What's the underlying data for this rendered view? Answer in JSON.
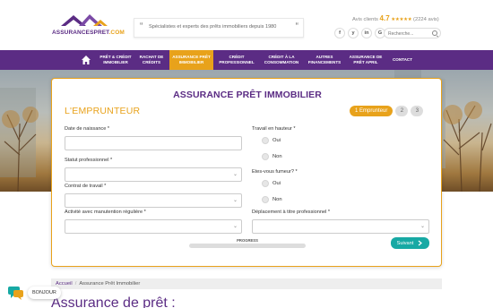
{
  "header": {
    "logo_text_main": "ASSURANCESPRET",
    "logo_text_accent": ".COM",
    "slogan": "Spécialistes et experts des prêts immobiliers depuis 1980",
    "reviews_label": "Avis clients",
    "reviews_score": "4.7",
    "reviews_stars": "★★★★★",
    "reviews_count": "(2224 avis)",
    "socials": [
      "f",
      "y",
      "in",
      "G"
    ],
    "search_placeholder": "Recherche..."
  },
  "nav": {
    "items": [
      {
        "label": "PRÊT & CRÉDIT IMMOBILIER"
      },
      {
        "label": "RACHAT DE CRÉDITS"
      },
      {
        "label": "ASSURANCE PRÊT IMMOBILIER"
      },
      {
        "label": "CRÉDIT PROFESSIONNEL"
      },
      {
        "label": "CRÉDIT À LA CONSOMMATION"
      },
      {
        "label": "AUTRES FINANCEMENTS"
      },
      {
        "label": "ASSURANCE DE PRÊT APRIL"
      },
      {
        "label": "CONTACT"
      }
    ],
    "active_index": 2
  },
  "form": {
    "title": "ASSURANCE PRÊT IMMOBILIER",
    "section": "L'EMPRUNTEUR",
    "steps": [
      "1 Emprunteur",
      "2",
      "3"
    ],
    "fields": {
      "birth_date": "Date de naissance *",
      "professional_status": "Statut professionnel *",
      "work_contract": "Contrat de travail *",
      "manual_activity": "Activité avec manutention régulière *",
      "height_work": "Travail en hauteur *",
      "smoker": "Etes-vous fumeur? *",
      "travel": "Déplacement à titre professionnel *"
    },
    "radio_yes": "Oui",
    "radio_no": "Non",
    "progress_label": "PROGRESS",
    "progress_fraction": 0,
    "next_button": "Suivant"
  },
  "breadcrumb": {
    "home": "Accueil",
    "separator": "/",
    "current": "Assurance Prêt Immobilier"
  },
  "page_heading": "Assurance de prêt :",
  "chat": {
    "label": "BONJOUR"
  },
  "colors": {
    "brand_purple": "#5b2c84",
    "accent_orange": "#e8a21b",
    "button_teal": "#17a9a4"
  }
}
